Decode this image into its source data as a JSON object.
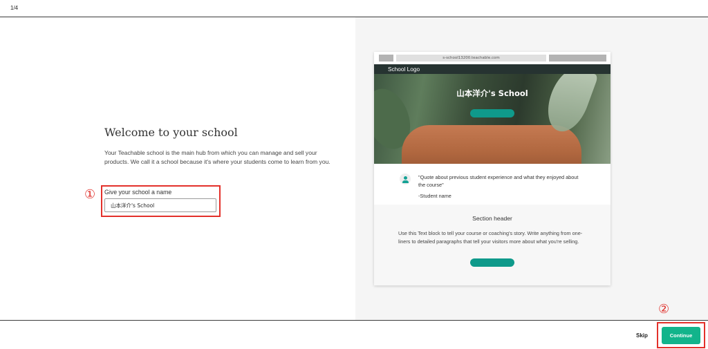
{
  "header": {
    "step": "1/4"
  },
  "main": {
    "title": "Welcome to your school",
    "description": "Your Teachable school is the main hub from which you can manage and sell your products. We call it a school because it's where your students come to learn from you.",
    "field_label": "Give your school a name",
    "school_name_value": "山本洋介's School",
    "annotation_1": "①"
  },
  "preview": {
    "url": "s-school13200.teachable.com",
    "logo": "School Logo",
    "hero_title": "山本洋介's School",
    "quote": "\"Quote about previous student experience and what they enjoyed about the course\"",
    "quote_author": "-Student name",
    "section_header": "Section header",
    "section_body": "Use this Text block to tell your course or coaching's story. Write anything from one-liners to detailed paragraphs that tell your visitors more about what you're selling."
  },
  "footer": {
    "skip_label": "Skip",
    "continue_label": "Continue",
    "annotation_2": "②"
  },
  "colors": {
    "accent": "#12b48b",
    "preview_button": "#0f9a8b",
    "annotation_red": "#e3302a",
    "navbar": "#263331"
  },
  "icons": {
    "student_avatar": "user-icon"
  }
}
